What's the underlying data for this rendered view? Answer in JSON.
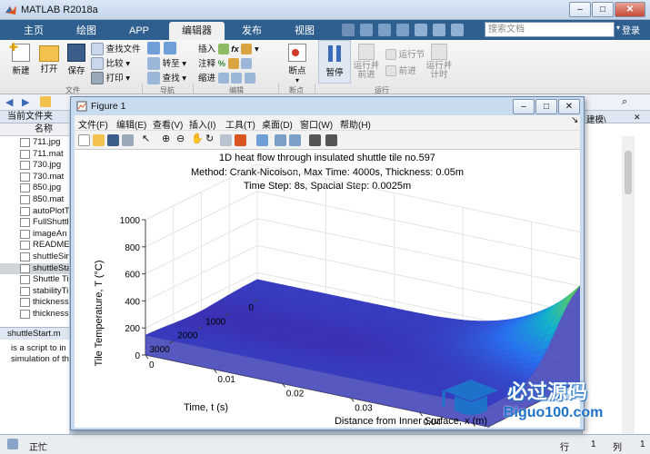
{
  "app": {
    "title": "MATLAB R2018a"
  },
  "tabs": [
    "主页",
    "绘图",
    "APP",
    "编辑器",
    "发布",
    "视图"
  ],
  "active_tab": "编辑器",
  "search": {
    "placeholder": "搜索文档"
  },
  "login": "登录",
  "ribbon": {
    "new": "新建",
    "open": "打开",
    "save": "保存",
    "find_files": "查找文件",
    "compare": "比较",
    "print": "打印",
    "goto": "转至",
    "find": "查找",
    "insert": "插入",
    "comment": "注释",
    "indent": "缩进",
    "breakpoints": "断点",
    "pause": "暂停",
    "run_section": "运行节",
    "advance": "前进",
    "run_advance": "运行并前进",
    "run_time": "运行并计时",
    "sections": [
      "文件",
      "导航",
      "编辑",
      "断点",
      "运行"
    ]
  },
  "left_panel": {
    "title": "当前文件夹",
    "name_header": "名称",
    "files": [
      "711.jpg",
      "711.mat",
      "730.jpg",
      "730.mat",
      "850.jpg",
      "850.mat",
      "autoPlotT",
      "FullShuttl",
      "imageAn",
      "READMEi",
      "shuttleSin",
      "shuttleSta",
      "Shuttle Ti",
      "stabilityTi",
      "thickness",
      "thickness"
    ],
    "selected_file": "shuttleSta",
    "detail_title": "shuttleStart.m",
    "detail_lines": [
      "is a script to in",
      "simulation of th"
    ]
  },
  "right_panel": {
    "label": "建模\\"
  },
  "status": {
    "left": "正忙",
    "row_label": "行",
    "row": "1",
    "col_label": "列",
    "col": "1"
  },
  "figure": {
    "title": "Figure 1",
    "menu": [
      "文件(F)",
      "编辑(E)",
      "查看(V)",
      "插入(I)",
      "工具(T)",
      "桌面(D)",
      "窗口(W)",
      "帮助(H)"
    ],
    "plot_title_lines": [
      "1D heat flow through insulated shuttle tile no.597",
      "Method: Crank-Nicolson, Max Time: 4000s, Thickness: 0.05m",
      "Time Step: 8s, Spacial Step: 0.0025m"
    ]
  },
  "chart_data": {
    "type": "surface",
    "title": "1D heat flow through insulated shuttle tile no.597",
    "xlabel": "Distance from Inner Surface, x (m)",
    "ylabel": "Time, t (s)",
    "zlabel": "Tile Temperature, T (°C)",
    "x_ticks": [
      "0",
      "0.01",
      "0.02",
      "0.03",
      "0.04",
      "0.05"
    ],
    "y_ticks": [
      "0",
      "1000",
      "2000",
      "3000"
    ],
    "z_ticks": [
      "0",
      "200",
      "400",
      "600",
      "800",
      "1000"
    ],
    "zlim": [
      0,
      1000
    ],
    "colormap": [
      "#3e26a8",
      "#2a6ef0",
      "#12b3cc",
      "#5ec962",
      "#fde725"
    ],
    "grid": true
  },
  "watermark": {
    "brand": "必过源码",
    "url": "Biguo100.com"
  }
}
